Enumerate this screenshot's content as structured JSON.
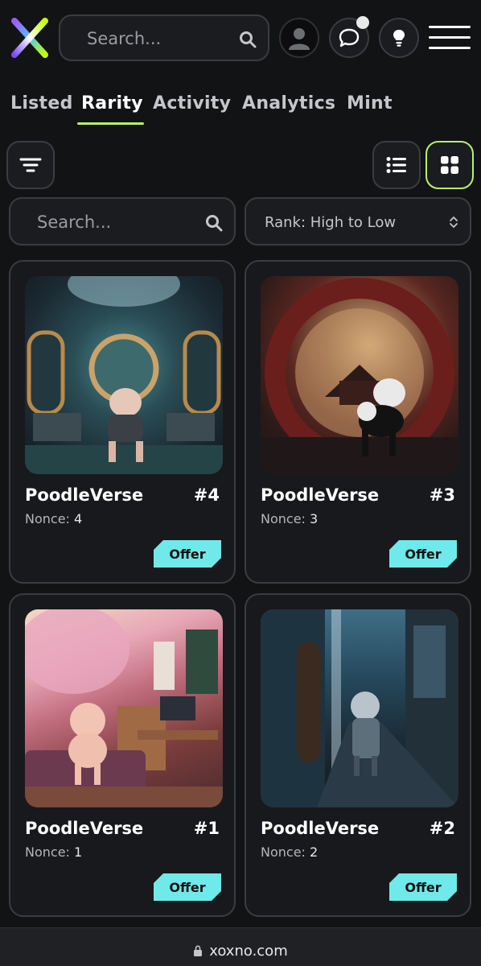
{
  "header": {
    "search_placeholder": "Search..."
  },
  "tabs": [
    {
      "label": "Listed",
      "active": false
    },
    {
      "label": "Rarity",
      "active": true
    },
    {
      "label": "Activity",
      "active": false
    },
    {
      "label": "Analytics",
      "active": false
    },
    {
      "label": "Mint",
      "active": false
    }
  ],
  "controls": {
    "search_placeholder": "Search...",
    "sort_value": "Rank: High to Low",
    "active_view": "grid"
  },
  "items": [
    {
      "name": "PoodleVerse",
      "number": "#4",
      "nonce_label": "Nonce:",
      "nonce": "4",
      "offer_label": "Offer"
    },
    {
      "name": "PoodleVerse",
      "number": "#3",
      "nonce_label": "Nonce:",
      "nonce": "3",
      "offer_label": "Offer"
    },
    {
      "name": "PoodleVerse",
      "number": "#1",
      "nonce_label": "Nonce:",
      "nonce": "1",
      "offer_label": "Offer"
    },
    {
      "name": "PoodleVerse",
      "number": "#2",
      "nonce_label": "Nonce:",
      "nonce": "2",
      "offer_label": "Offer"
    }
  ],
  "browser": {
    "url": "xoxno.com"
  },
  "colors": {
    "background": "#121315",
    "accent_green": "#b8f36c",
    "offer_cyan": "#6fe9ea",
    "border": "#3a3c40"
  },
  "icons": [
    "xoxno-logo-icon",
    "search-icon",
    "user-icon",
    "chat-icon",
    "lightbulb-icon",
    "hamburger-menu-icon",
    "filter-icon",
    "list-view-icon",
    "grid-view-icon",
    "chevron-updown-icon",
    "lock-icon"
  ]
}
